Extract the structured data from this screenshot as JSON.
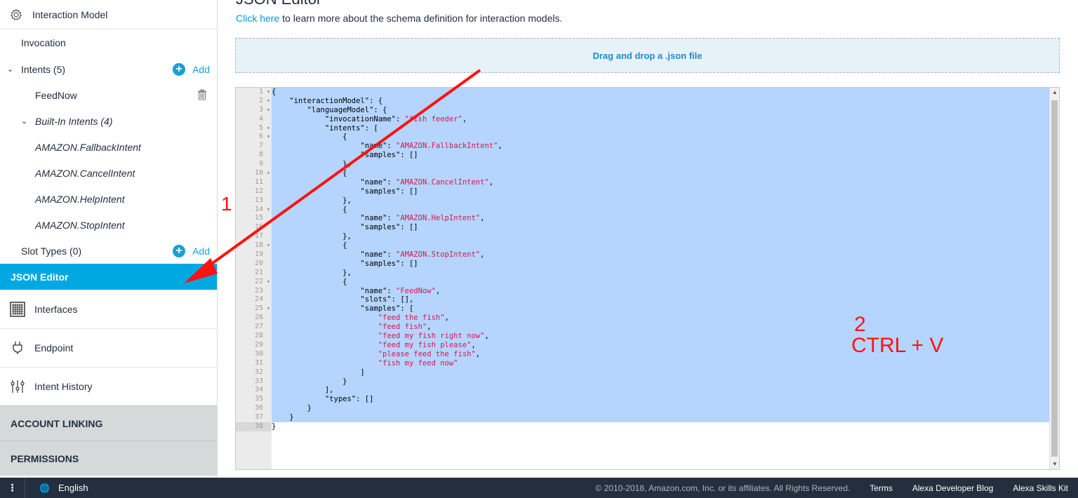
{
  "sidebar": {
    "header": "Interaction Model",
    "invocation": "Invocation",
    "intents_label": "Intents (5)",
    "add_label": "Add",
    "feednow": "FeedNow",
    "builtin_label": "Built-In Intents (4)",
    "builtin_items": [
      "AMAZON.FallbackIntent",
      "AMAZON.CancelIntent",
      "AMAZON.HelpIntent",
      "AMAZON.StopIntent"
    ],
    "slot_types_label": "Slot Types (0)",
    "json_editor": "JSON Editor",
    "interfaces": "Interfaces",
    "endpoint": "Endpoint",
    "intent_history": "Intent History",
    "account_linking": "ACCOUNT LINKING",
    "permissions": "PERMISSIONS"
  },
  "main": {
    "title": "JSON Editor",
    "learn_link": "Click here",
    "learn_rest": " to learn more about the schema definition for interaction models.",
    "dropzone": "Drag and drop a .json file"
  },
  "editor": {
    "line_count": 38,
    "lines": [
      "{",
      "    \"interactionModel\": {",
      "        \"languageModel\": {",
      "            \"invocationName\": \"fish feeder\",",
      "            \"intents\": [",
      "                {",
      "                    \"name\": \"AMAZON.FallbackIntent\",",
      "                    \"samples\": []",
      "                },",
      "                {",
      "                    \"name\": \"AMAZON.CancelIntent\",",
      "                    \"samples\": []",
      "                },",
      "                {",
      "                    \"name\": \"AMAZON.HelpIntent\",",
      "                    \"samples\": []",
      "                },",
      "                {",
      "                    \"name\": \"AMAZON.StopIntent\",",
      "                    \"samples\": []",
      "                },",
      "                {",
      "                    \"name\": \"FeedNow\",",
      "                    \"slots\": [],",
      "                    \"samples\": [",
      "                        \"feed the fish\",",
      "                        \"feed fish\",",
      "                        \"feed my fish right now\",",
      "                        \"feed my fish please\",",
      "                        \"please feed the fish\",",
      "                        \"fish my feed now\"",
      "                    ]",
      "                }",
      "            ],",
      "            \"types\": []",
      "        }",
      "    }",
      "}"
    ],
    "fold_lines": [
      1,
      2,
      3,
      5,
      6,
      10,
      14,
      18,
      22,
      25
    ]
  },
  "annotations": {
    "step1": "1",
    "step2_num": "2",
    "step2_text": "CTRL + V",
    "color": "#ff1212"
  },
  "footer": {
    "menu": "⋮",
    "language": "English",
    "copyright": "© 2010-2018, Amazon.com, Inc. or its affiliates. All Rights Reserved.",
    "links": [
      "Terms",
      "Alexa Developer Blog",
      "Alexa Skills Kit"
    ]
  }
}
